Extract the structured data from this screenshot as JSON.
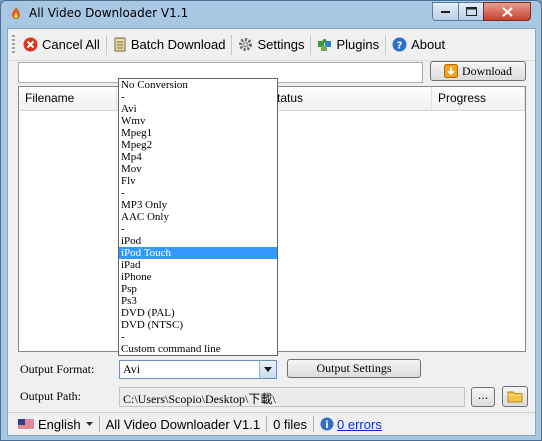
{
  "window": {
    "title": "All Video Downloader V1.1"
  },
  "toolbar": {
    "cancel_all": "Cancel All",
    "batch_download": "Batch Download",
    "settings": "Settings",
    "plugins": "Plugins",
    "about": "About"
  },
  "url": {
    "value": "",
    "download_label": "Download"
  },
  "list": {
    "columns": [
      "Filename",
      "Status",
      "Progress"
    ]
  },
  "output": {
    "format_label": "Output Format:",
    "format_value": "Avi",
    "settings_button": "Output Settings",
    "path_label": "Output Path:",
    "path_value": "C:\\Users\\Scopio\\Desktop\\下載\\",
    "browse_label": "..."
  },
  "format_options": [
    "No Conversion",
    "-",
    "Avi",
    "Wmv",
    "Mpeg1",
    "Mpeg2",
    "Mp4",
    "Mov",
    "Flv",
    "-",
    "MP3 Only",
    "AAC Only",
    "-",
    "iPod",
    "iPod Touch",
    "iPad",
    "iPhone",
    "Psp",
    "Ps3",
    "DVD (PAL)",
    "DVD (NTSC)",
    "-",
    "Custom command line"
  ],
  "format_selected_index": 14,
  "statusbar": {
    "language": "English",
    "app_name": "All Video Downloader V1.1",
    "files": "0 files",
    "errors": "0 errors"
  },
  "colors": {
    "selection": "#3399ff",
    "link": "#0033cc"
  }
}
